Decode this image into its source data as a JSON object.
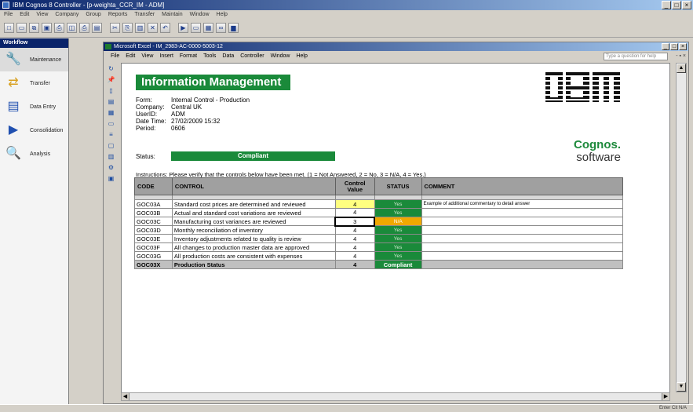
{
  "app": {
    "title": "IBM Cognos 8 Controller - [p-weighta_CCR_IM - ADM]",
    "menu": [
      "File",
      "Edit",
      "View",
      "Company",
      "Group",
      "Reports",
      "Transfer",
      "Maintain",
      "Window",
      "Help"
    ],
    "toolbar_icons": [
      "new-icon",
      "open-icon",
      "copy-icon",
      "save-icon",
      "print-icon",
      "print-preview-icon",
      "printer-icon",
      "report-icon",
      "cut-icon",
      "copy-doc-icon",
      "paste-icon",
      "delete-icon",
      "undo-icon",
      "run-icon",
      "layout-icon",
      "grid-icon",
      "binoculars-icon",
      "chart-icon"
    ]
  },
  "workflow": {
    "header": "Workflow",
    "items": [
      {
        "label": "Maintenance",
        "icon": "wrench-icon",
        "active": true
      },
      {
        "label": "Transfer",
        "icon": "transfer-icon",
        "active": false
      },
      {
        "label": "Data Entry",
        "icon": "data-entry-icon",
        "active": false
      },
      {
        "label": "Consolidation",
        "icon": "consolidation-icon",
        "active": false
      },
      {
        "label": "Analysis",
        "icon": "analysis-icon",
        "active": false
      }
    ]
  },
  "excel": {
    "title": "Microsoft Excel - IM_2983-AC-0000-5003-12",
    "menu": [
      "File",
      "Edit",
      "View",
      "Insert",
      "Format",
      "Tools",
      "Data",
      "Controller",
      "Window",
      "Help"
    ],
    "help_placeholder": "Type a question for help",
    "window_controls": "- ▪ ×"
  },
  "sheet": {
    "header_title": "Information Management",
    "brand_logo_text": "IBM",
    "brand_line1": "Cognos.",
    "brand_line2": "software",
    "info": [
      {
        "key": "Form:",
        "value": "Internal Control - Production"
      },
      {
        "key": "Company:",
        "value": "Central UK"
      },
      {
        "key": "UserID:",
        "value": "ADM"
      },
      {
        "key": "Date Time:",
        "value": "27/02/2009 15:32"
      },
      {
        "key": "Period:",
        "value": "0606"
      }
    ],
    "status_label": "Status:",
    "status_value": "Compliant",
    "instructions": "Instructions: Please verify that the controls below have been met. (1 = Not Answered, 2 = No, 3 = N/A, 4 = Yes.)",
    "table": {
      "headers": {
        "code": "CODE",
        "control": "CONTROL",
        "value_line1": "Control",
        "value_line2": "Value",
        "status": "STATUS",
        "comment": "COMMENT"
      },
      "rows": [
        {
          "code": "GOC03A",
          "control": "Standard cost prices are determined and reviewed",
          "value": "4",
          "status": "Yes",
          "comment": "Example of additional commentary to detail answer",
          "highlight": true,
          "selected": false,
          "na": false
        },
        {
          "code": "GOC03B",
          "control": "Actual and standard cost variations are reviewed",
          "value": "4",
          "status": "Yes",
          "comment": "",
          "highlight": false,
          "selected": false,
          "na": false
        },
        {
          "code": "GOC03C",
          "control": "Manufacturing cost variances are reviewed",
          "value": "3",
          "status": "N/A",
          "comment": "",
          "highlight": false,
          "selected": true,
          "na": true
        },
        {
          "code": "GOC03D",
          "control": "Monthly reconciliation of inventory",
          "value": "4",
          "status": "Yes",
          "comment": "",
          "highlight": false,
          "selected": false,
          "na": false
        },
        {
          "code": "GOC03E",
          "control": "Inventory adjustments related to quality is review",
          "value": "4",
          "status": "Yes",
          "comment": "",
          "highlight": false,
          "selected": false,
          "na": false
        },
        {
          "code": "GOC03F",
          "control": "All changes to production master data are approved",
          "value": "4",
          "status": "Yes",
          "comment": "",
          "highlight": false,
          "selected": false,
          "na": false
        },
        {
          "code": "GOC03G",
          "control": "All production costs are consistent with expenses",
          "value": "4",
          "status": "Yes",
          "comment": "",
          "highlight": false,
          "selected": false,
          "na": false
        }
      ],
      "total": {
        "code": "GOC03X",
        "control": "Production Status",
        "value": "4",
        "status": "Compliant"
      }
    }
  },
  "statusbar": {
    "text": "Enter  Cit   N/A"
  }
}
